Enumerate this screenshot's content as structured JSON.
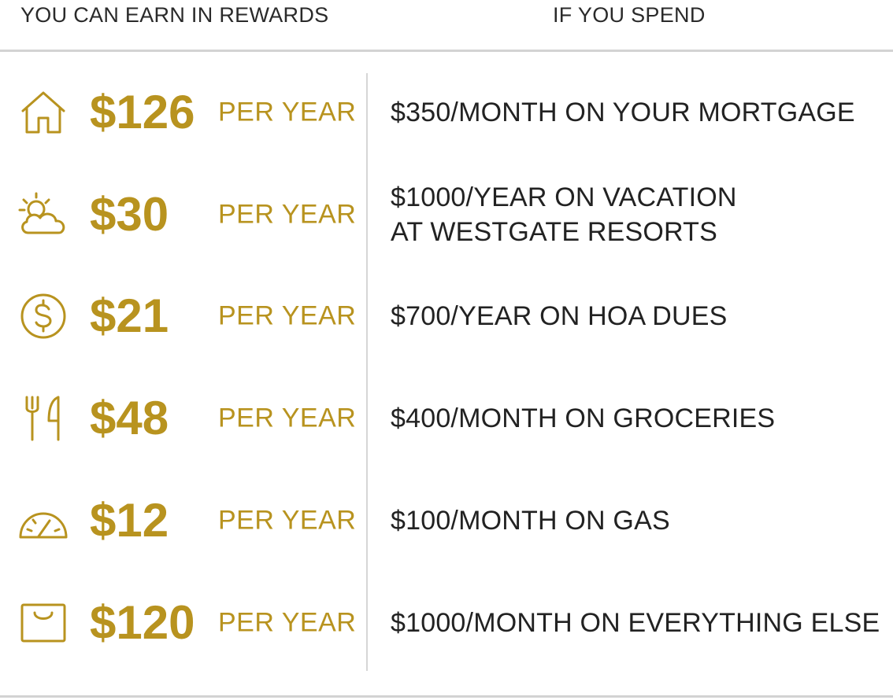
{
  "header": {
    "left_label": "YOU CAN EARN IN REWARDS",
    "right_label": "IF YOU SPEND"
  },
  "colors": {
    "accent": "#b8931f",
    "text": "#222222",
    "divider": "#d3d3d3"
  },
  "rows": [
    {
      "icon": "home-icon",
      "amount": "$126",
      "period": "PER YEAR",
      "spend_line1": "$350/MONTH ON YOUR MORTGAGE",
      "spend_line2": ""
    },
    {
      "icon": "sun-cloud-icon",
      "amount": "$30",
      "period": "PER YEAR",
      "spend_line1": "$1000/YEAR ON VACATION",
      "spend_line2": "AT WESTGATE RESORTS"
    },
    {
      "icon": "dollar-circle-icon",
      "amount": "$21",
      "period": "PER YEAR",
      "spend_line1": "$700/YEAR ON HOA DUES",
      "spend_line2": ""
    },
    {
      "icon": "fork-knife-icon",
      "amount": "$48",
      "period": "PER YEAR",
      "spend_line1": "$400/MONTH ON GROCERIES",
      "spend_line2": ""
    },
    {
      "icon": "gauge-icon",
      "amount": "$12",
      "period": "PER YEAR",
      "spend_line1": "$100/MONTH ON GAS",
      "spend_line2": ""
    },
    {
      "icon": "shopping-bag-icon",
      "amount": "$120",
      "period": "PER YEAR",
      "spend_line1": "$1000/MONTH ON EVERYTHING ELSE",
      "spend_line2": ""
    }
  ]
}
